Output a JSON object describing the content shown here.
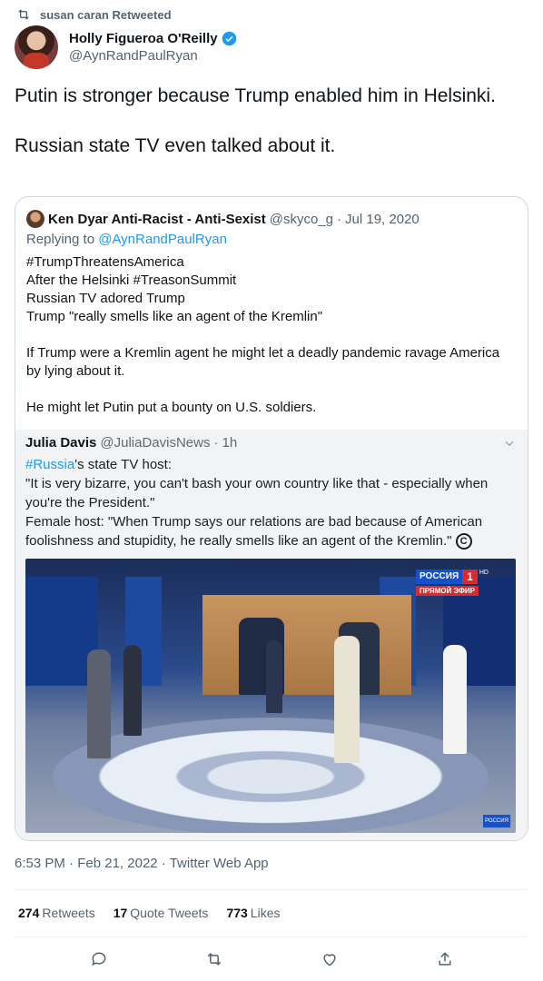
{
  "retweet_banner": {
    "text": "susan caran Retweeted"
  },
  "author": {
    "display_name": "Holly Figueroa O'Reilly",
    "handle": "@AynRandPaulRyan"
  },
  "tweet": {
    "paragraphs": [
      "Putin is stronger because Trump enabled him in Helsinki.",
      "Russian state TV even talked about it."
    ]
  },
  "quote": {
    "display_name": "Ken Dyar Anti-Racist - Anti-Sexist",
    "handle": "@skyco_g",
    "date": "Jul 19, 2020",
    "replying_prefix": "Replying to",
    "replying_to": "@AynRandPaulRyan",
    "lines": [
      "#TrumpThreatensAmerica",
      "After the Helsinki #TreasonSummit",
      "Russian TV adored Trump",
      "Trump \"really smells like an agent of the Kremlin\""
    ],
    "paragraph2": "If Trump were a Kremlin agent he might let a deadly pandemic ravage America by lying about it.",
    "paragraph3": "He might let Putin put a bounty on U.S. soldiers."
  },
  "embed": {
    "display_name": "Julia Davis",
    "handle": "@JuliaDavisNews",
    "time": "1h",
    "hashtag": "#Russia",
    "line1_rest": "'s state TV host:",
    "line2": "\"It is very bizarre, you can't bash your own country like that - especially when you're the President.\"",
    "line3": "Female host: \"When Trump says our relations are bad because of American foolishness and stupidity, he really smells like an agent of the Kremlin.\"",
    "copyright_symbol": "C",
    "video": {
      "channel_name": "РОССИЯ",
      "channel_number": "1",
      "live_label": "ПРЯМОЙ ЭФИР",
      "hd_label": "HD",
      "corner_label": "РОССИЯ"
    }
  },
  "meta": {
    "time": "6:53 PM",
    "date": "Feb 21, 2022",
    "source": "Twitter Web App",
    "separator": "·"
  },
  "stats": {
    "retweets_count": "274",
    "retweets_label": "Retweets",
    "quotes_count": "17",
    "quotes_label": "Quote Tweets",
    "likes_count": "773",
    "likes_label": "Likes"
  },
  "colors": {
    "accent": "#1d9bf0",
    "secondary_text": "#536471",
    "border": "#cfd9de"
  }
}
